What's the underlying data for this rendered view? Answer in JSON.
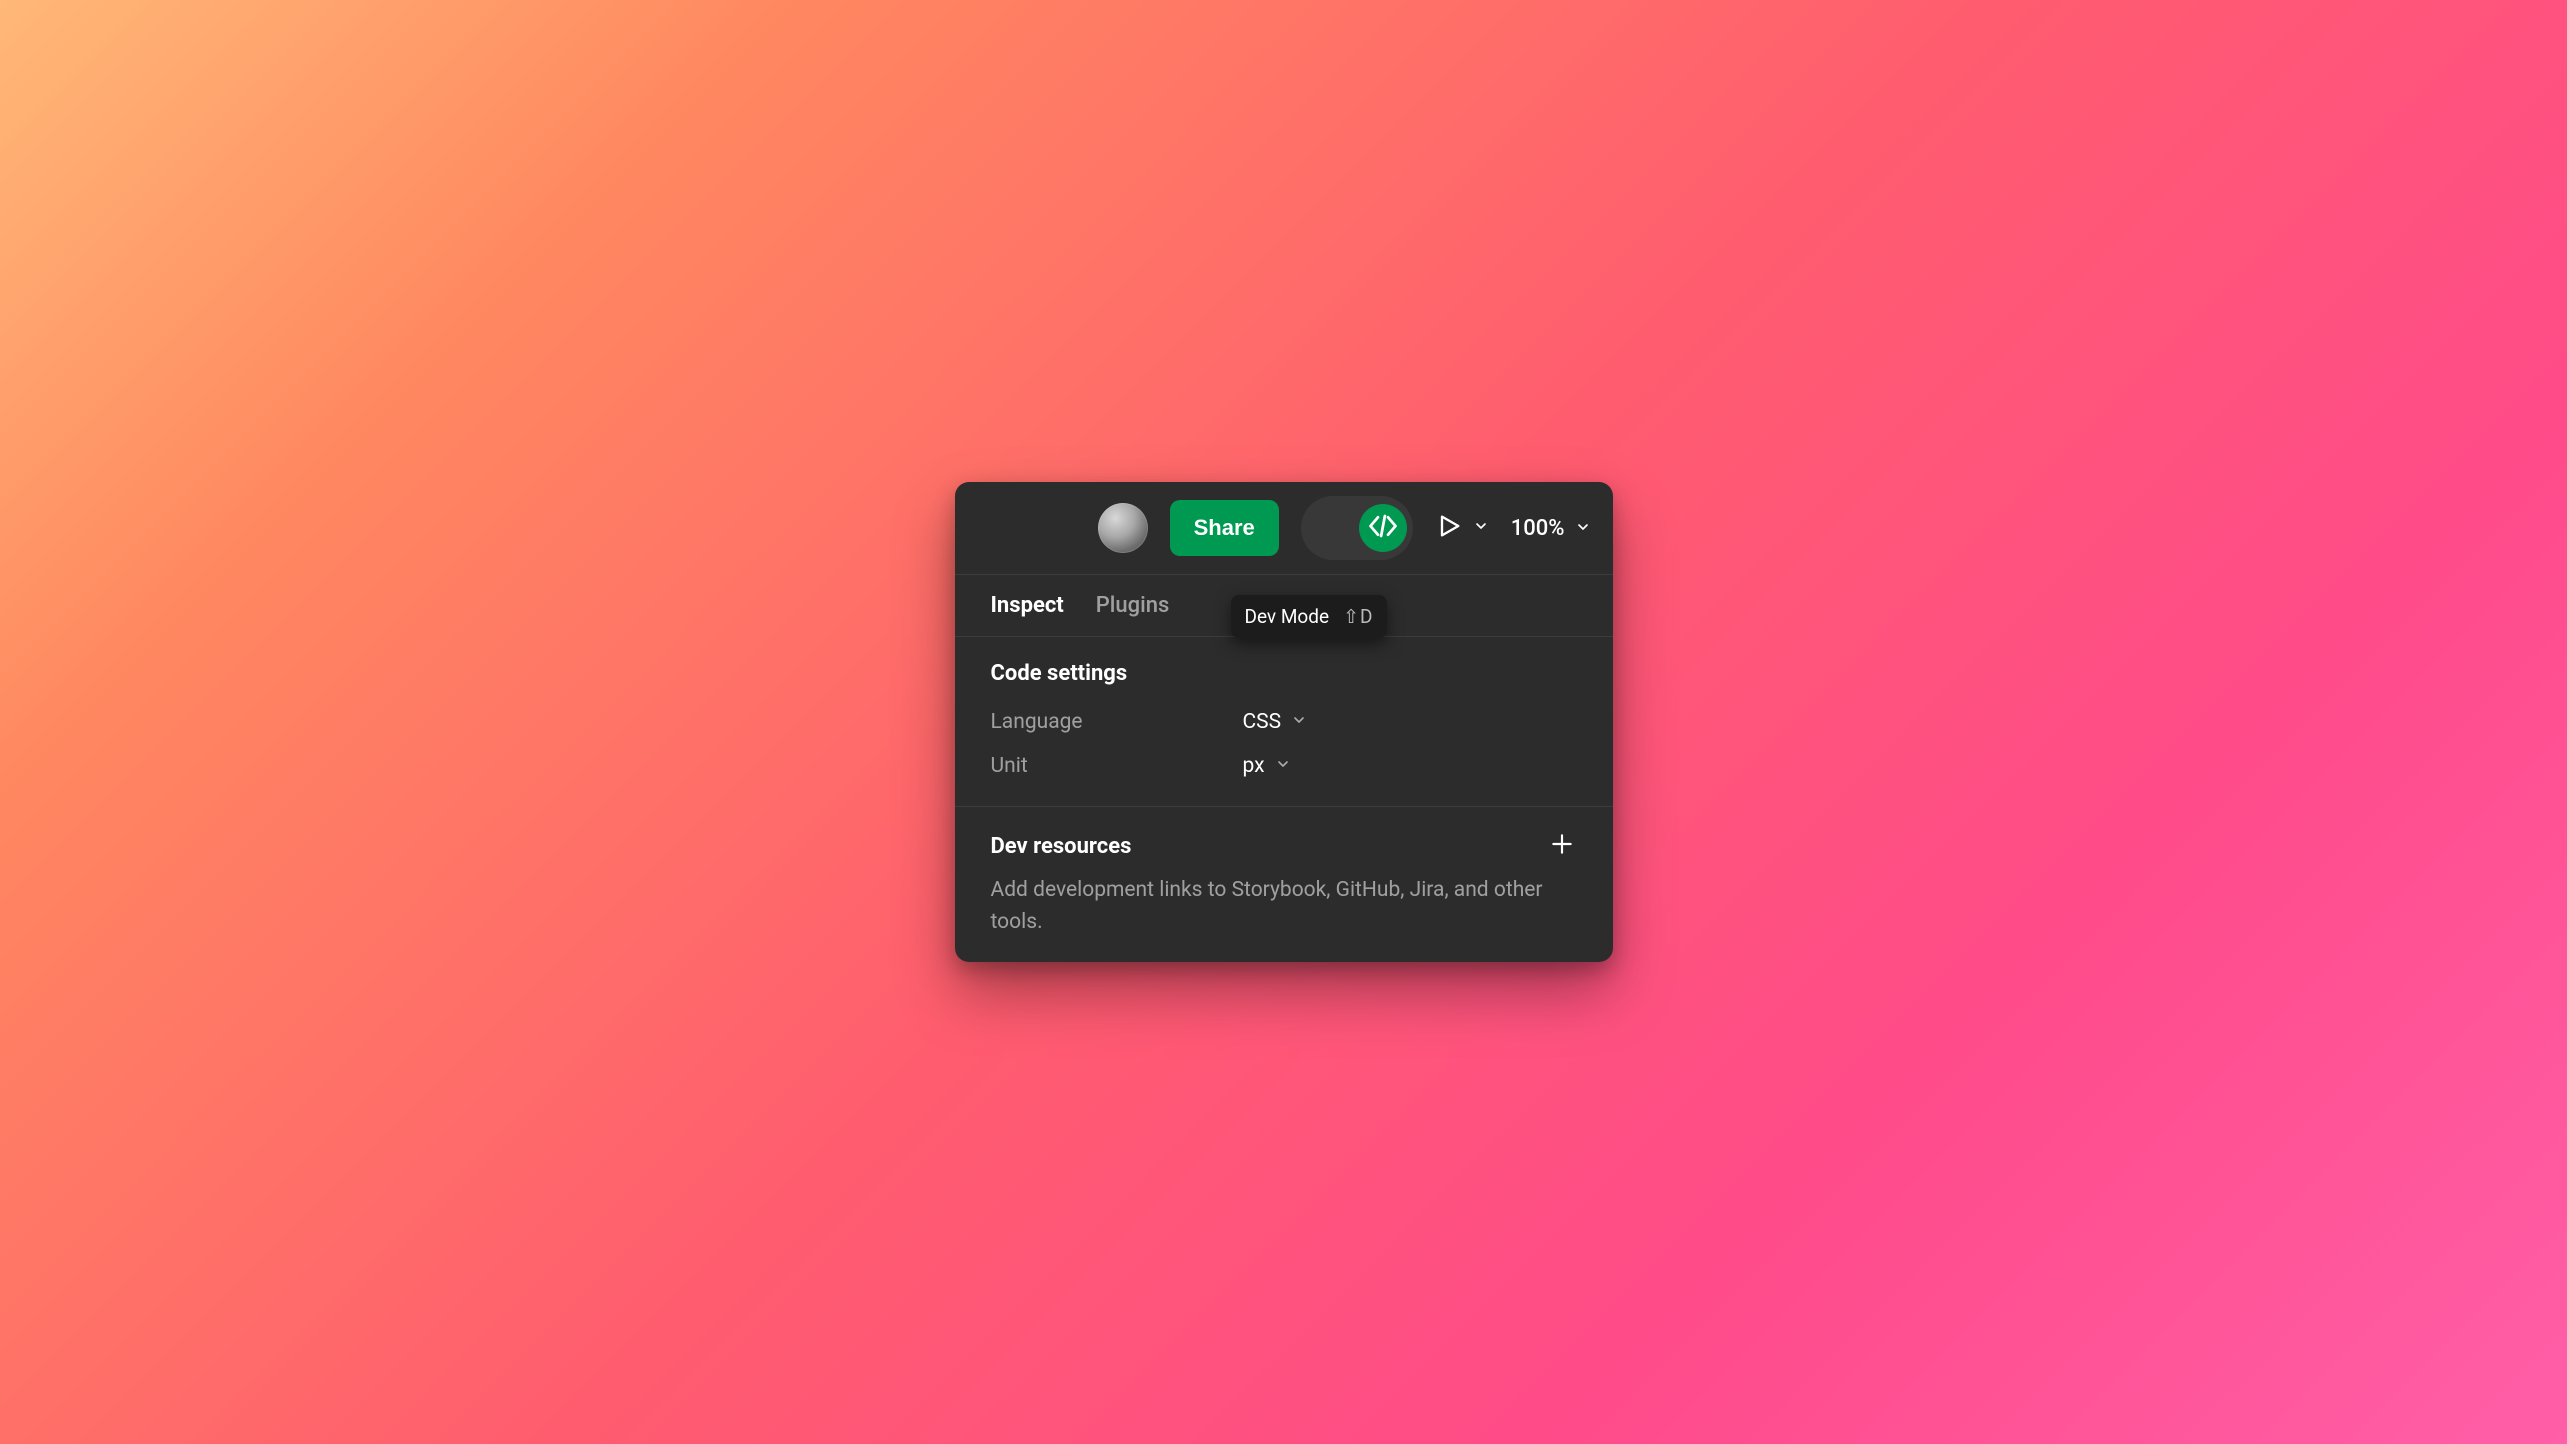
{
  "toolbar": {
    "share_label": "Share",
    "zoom_value": "100%",
    "dev_mode_active": true
  },
  "tooltip": {
    "label": "Dev Mode",
    "shortcut": "⇧D"
  },
  "tabs": {
    "inspect": "Inspect",
    "plugins": "Plugins",
    "active": "inspect"
  },
  "code_settings": {
    "title": "Code settings",
    "language_label": "Language",
    "language_value": "CSS",
    "unit_label": "Unit",
    "unit_value": "px"
  },
  "dev_resources": {
    "title": "Dev resources",
    "description": "Add development links to Storybook, GitHub, Jira, and other tools."
  },
  "colors": {
    "accent": "#009951",
    "panel_bg": "#2c2c2c"
  }
}
